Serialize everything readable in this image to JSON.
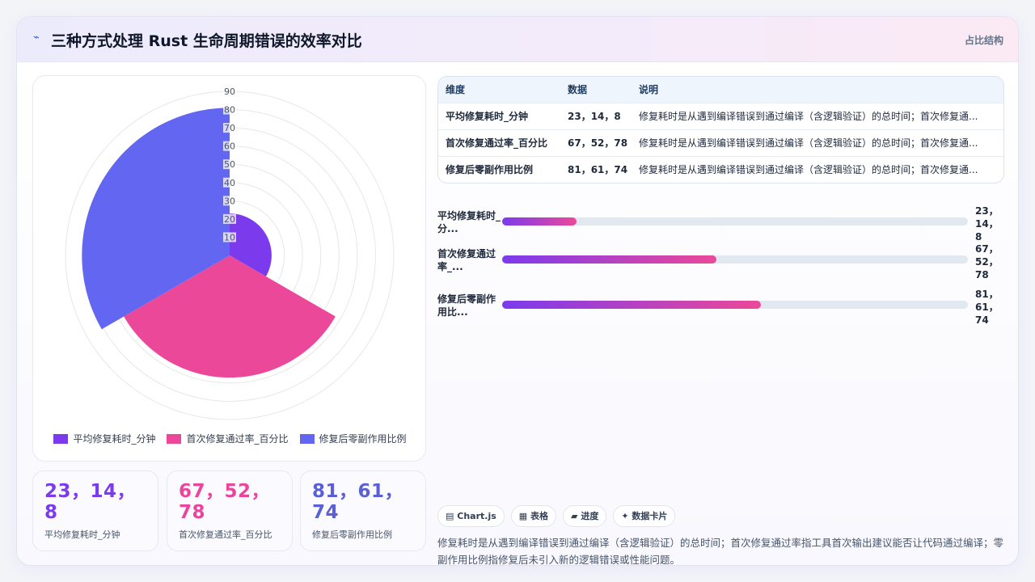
{
  "header": {
    "icon": "sparkle-icon",
    "title": "三种方式处理 Rust 生命周期错误的效率对比",
    "right_label": "占比结构"
  },
  "chart_data": {
    "type": "polar-area",
    "r_ticks": [
      "10",
      "20",
      "30",
      "40",
      "50",
      "60",
      "70",
      "80",
      "90"
    ],
    "r_max": 90,
    "slices": [
      {
        "name": "平均修复耗时_分钟",
        "value": 23,
        "color": "#7c3aed"
      },
      {
        "name": "首次修复通过率_百分比",
        "value": 67,
        "color": "#ec4899"
      },
      {
        "name": "修复后零副作用比例",
        "value": 81,
        "color": "#6366f1"
      }
    ]
  },
  "stats": [
    {
      "value": "23，14，8",
      "label": "平均修复耗时_分钟",
      "color": "#7c3aed"
    },
    {
      "value": "67，52，78",
      "label": "首次修复通过率_百分比",
      "color": "#e8459b"
    },
    {
      "value": "81，61，74",
      "label": "修复后零副作用比例",
      "color": "#5b5fd6"
    }
  ],
  "table": {
    "headers": [
      "维度",
      "数据",
      "说明"
    ],
    "rows": [
      {
        "dim": "平均修复耗时_分钟",
        "data": "23，14，8",
        "desc": "修复耗时是从遇到编译错误到通过编译（含逻辑验证）的总时间；首次修复通..."
      },
      {
        "dim": "首次修复通过率_百分比",
        "data": "67，52，78",
        "desc": "修复耗时是从遇到编译错误到通过编译（含逻辑验证）的总时间；首次修复通..."
      },
      {
        "dim": "修复后零副作用比例",
        "data": "81，61，74",
        "desc": "修复耗时是从遇到编译错误到通过编译（含逻辑验证）的总时间；首次修复通..."
      }
    ]
  },
  "progress": [
    {
      "label": "平均修复耗时_分...",
      "value": "23，14，8",
      "fraction": 0.16
    },
    {
      "label": "首次修复通过率_...",
      "value": "67，52，78",
      "fraction": 0.46
    },
    {
      "label": "修复后零副作用比...",
      "value": "81，61，74",
      "fraction": 0.556
    }
  ],
  "chips": [
    {
      "icon": "chart-icon",
      "glyph": "▤",
      "label": "Chart.js"
    },
    {
      "icon": "table-icon",
      "glyph": "▦",
      "label": "表格"
    },
    {
      "icon": "progress-icon",
      "glyph": "▰",
      "label": "进度"
    },
    {
      "icon": "sparkle-icon",
      "glyph": "✦",
      "label": "数据卡片"
    }
  ],
  "note": "修复耗时是从遇到编译错误到通过编译（含逻辑验证）的总时间；首次修复通过率指工具首次输出建议能否让代码通过编译；零副作用比例指修复后未引入新的逻辑错误或性能问题。"
}
